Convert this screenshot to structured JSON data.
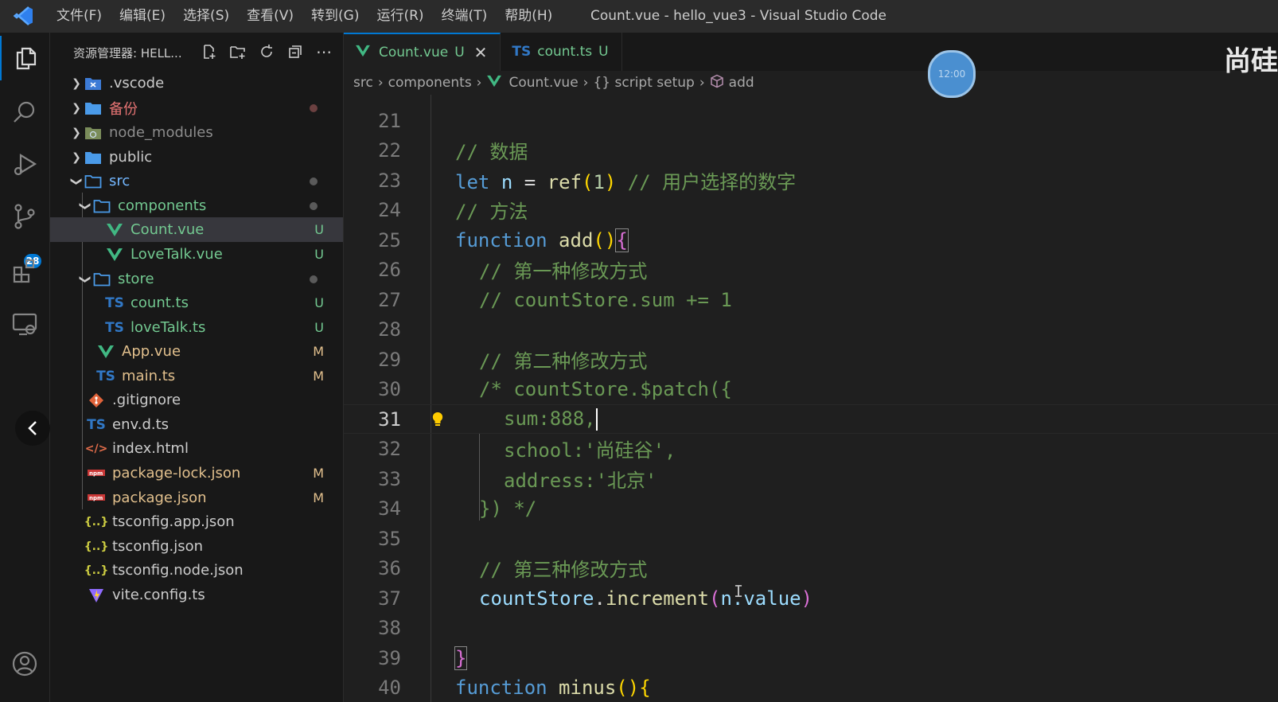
{
  "titlebar": {
    "menu": [
      "文件(F)",
      "编辑(E)",
      "选择(S)",
      "查看(V)",
      "转到(G)",
      "运行(R)",
      "终端(T)",
      "帮助(H)"
    ],
    "window_title": "Count.vue - hello_vue3 - Visual Studio Code"
  },
  "activity_bar": {
    "items": [
      "explorer-icon",
      "search-icon",
      "run-debug-icon",
      "source-control-icon",
      "extensions-icon",
      "remote-explorer-icon",
      "account-icon"
    ],
    "source_control_badge": "28"
  },
  "sidebar": {
    "title": "资源管理器: HELL...",
    "tree": [
      {
        "name": ".vscode",
        "type": "folder",
        "status": ""
      },
      {
        "name": "备份",
        "type": "folder",
        "status": "dot"
      },
      {
        "name": "node_modules",
        "type": "folder",
        "status": ""
      },
      {
        "name": "public",
        "type": "folder",
        "status": ""
      },
      {
        "name": "src",
        "type": "folder",
        "status": "dot"
      },
      {
        "name": "components",
        "type": "folder",
        "status": "dot"
      },
      {
        "name": "Count.vue",
        "type": "vue",
        "status": "U"
      },
      {
        "name": "LoveTalk.vue",
        "type": "vue",
        "status": "U"
      },
      {
        "name": "store",
        "type": "folder",
        "status": "dot"
      },
      {
        "name": "count.ts",
        "type": "ts",
        "status": "U"
      },
      {
        "name": "loveTalk.ts",
        "type": "ts",
        "status": "U"
      },
      {
        "name": "App.vue",
        "type": "vue",
        "status": "M"
      },
      {
        "name": "main.ts",
        "type": "ts",
        "status": "M"
      },
      {
        "name": ".gitignore",
        "type": "git",
        "status": ""
      },
      {
        "name": "env.d.ts",
        "type": "ts",
        "status": ""
      },
      {
        "name": "index.html",
        "type": "html",
        "status": ""
      },
      {
        "name": "package-lock.json",
        "type": "npm",
        "status": "M"
      },
      {
        "name": "package.json",
        "type": "npm",
        "status": "M"
      },
      {
        "name": "tsconfig.app.json",
        "type": "json",
        "status": ""
      },
      {
        "name": "tsconfig.json",
        "type": "json",
        "status": ""
      },
      {
        "name": "tsconfig.node.json",
        "type": "json",
        "status": ""
      },
      {
        "name": "vite.config.ts",
        "type": "vite",
        "status": ""
      }
    ]
  },
  "tabs": [
    {
      "icon": "V",
      "label": "Count.vue",
      "mark": "U",
      "active": true
    },
    {
      "icon": "TS",
      "label": "count.ts",
      "mark": "U",
      "active": false
    }
  ],
  "watermark": "尚硅",
  "timer": "12:00",
  "breadcrumb": [
    "src",
    "components",
    "Count.vue",
    "{} script setup",
    "add"
  ],
  "code": {
    "current_line": 31,
    "lines": [
      {
        "n": "21"
      },
      {
        "n": "22"
      },
      {
        "n": "23"
      },
      {
        "n": "24"
      },
      {
        "n": "25"
      },
      {
        "n": "26"
      },
      {
        "n": "27"
      },
      {
        "n": "28"
      },
      {
        "n": "29"
      },
      {
        "n": "30"
      },
      {
        "n": "31"
      },
      {
        "n": "32"
      },
      {
        "n": "33"
      },
      {
        "n": "34"
      },
      {
        "n": "35"
      },
      {
        "n": "36"
      },
      {
        "n": "37"
      },
      {
        "n": "38"
      },
      {
        "n": "39"
      },
      {
        "n": "40"
      }
    ],
    "tokens": {
      "l22": "// 数据",
      "l23_kw": "let",
      "l23_var": "n",
      "l23_eq": " = ",
      "l23_fn": "ref",
      "l23_num": "1",
      "l23_cm": "// 用户选择的数字",
      "l24": "// 方法",
      "l25_kw": "function",
      "l25_fn": "add",
      "l26": "// 第一种修改方式",
      "l27": "// countStore.sum += 1",
      "l29": "// 第二种修改方式",
      "l30": "/* countStore.$patch({",
      "l31": "sum:888,",
      "l32": "school:'尚硅谷',",
      "l33": "address:'北京'",
      "l34": "}) */",
      "l36": "// 第三种修改方式",
      "l37_obj": "countStore",
      "l37_fn": "increment",
      "l37_arg": "n.value",
      "l39": "}",
      "l40_kw": "function",
      "l40_fn": "minus"
    }
  }
}
